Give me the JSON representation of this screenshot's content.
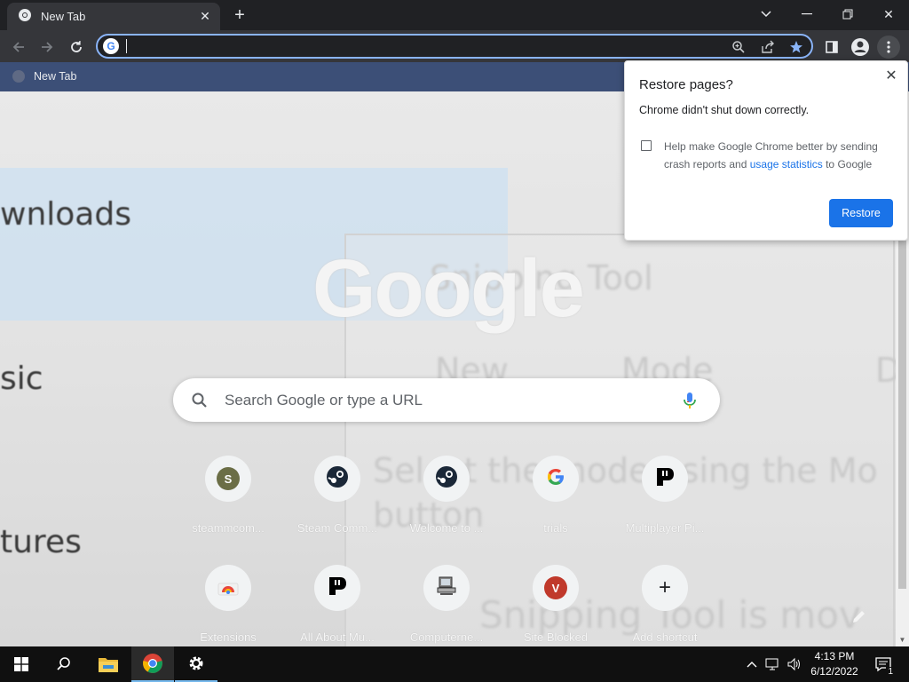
{
  "browser": {
    "tab_title": "New Tab",
    "omnibox_value": "",
    "bookmarks": [
      {
        "label": "New Tab"
      }
    ]
  },
  "background_words": [
    "wnloads",
    "sic",
    "tures",
    "Snipping Tool",
    "New",
    "Mode",
    "Select the mode using the Mo",
    "button",
    "Snipping Tool is mov",
    "D"
  ],
  "ntp": {
    "logo": "Google",
    "search_placeholder": "Search Google or type a URL",
    "shortcuts": [
      {
        "label": "steammcom...",
        "icon": "S",
        "icon_name": "letter-s-favicon",
        "color": "#6b6e46"
      },
      {
        "label": "Steam Comm...",
        "icon": "",
        "icon_name": "steam-icon",
        "color": "#1b2838"
      },
      {
        "label": "Welcome to ...",
        "icon": "",
        "icon_name": "steam-icon",
        "color": "#1b2838"
      },
      {
        "label": "trials",
        "icon": "G",
        "icon_name": "google-g-icon",
        "color": "#4285f4"
      },
      {
        "label": "Multiplayer Pi...",
        "icon": "P",
        "icon_name": "piano-p-icon",
        "color": "#000000"
      },
      {
        "label": "Extensions",
        "icon": "",
        "icon_name": "chrome-web-store-icon",
        "color": "#e8453c"
      },
      {
        "label": "All About Mu...",
        "icon": "P",
        "icon_name": "piano-p-icon",
        "color": "#000000"
      },
      {
        "label": "Computerne...",
        "icon": "",
        "icon_name": "computer-icon",
        "color": "#444444"
      },
      {
        "label": "Site Blocked",
        "icon": "V",
        "icon_name": "letter-v-favicon",
        "color": "#c0392b"
      },
      {
        "label": "Add shortcut",
        "icon": "+",
        "icon_name": "add-icon",
        "color": "#202124"
      }
    ]
  },
  "restore_popup": {
    "title": "Restore pages?",
    "message": "Chrome didn't shut down correctly.",
    "checkbox_text_before": "Help make Google Chrome better by sending crash reports and ",
    "checkbox_link": "usage statistics",
    "checkbox_text_after": " to Google",
    "checkbox_checked": false,
    "button_label": "Restore"
  },
  "taskbar": {
    "time": "4:13 PM",
    "date": "6/12/2022",
    "notification_count": "1"
  },
  "colors": {
    "accent": "#1a73e8",
    "omnibox_focus": "#8ab4f8",
    "bookmarks_bar": "#3c4f77"
  }
}
